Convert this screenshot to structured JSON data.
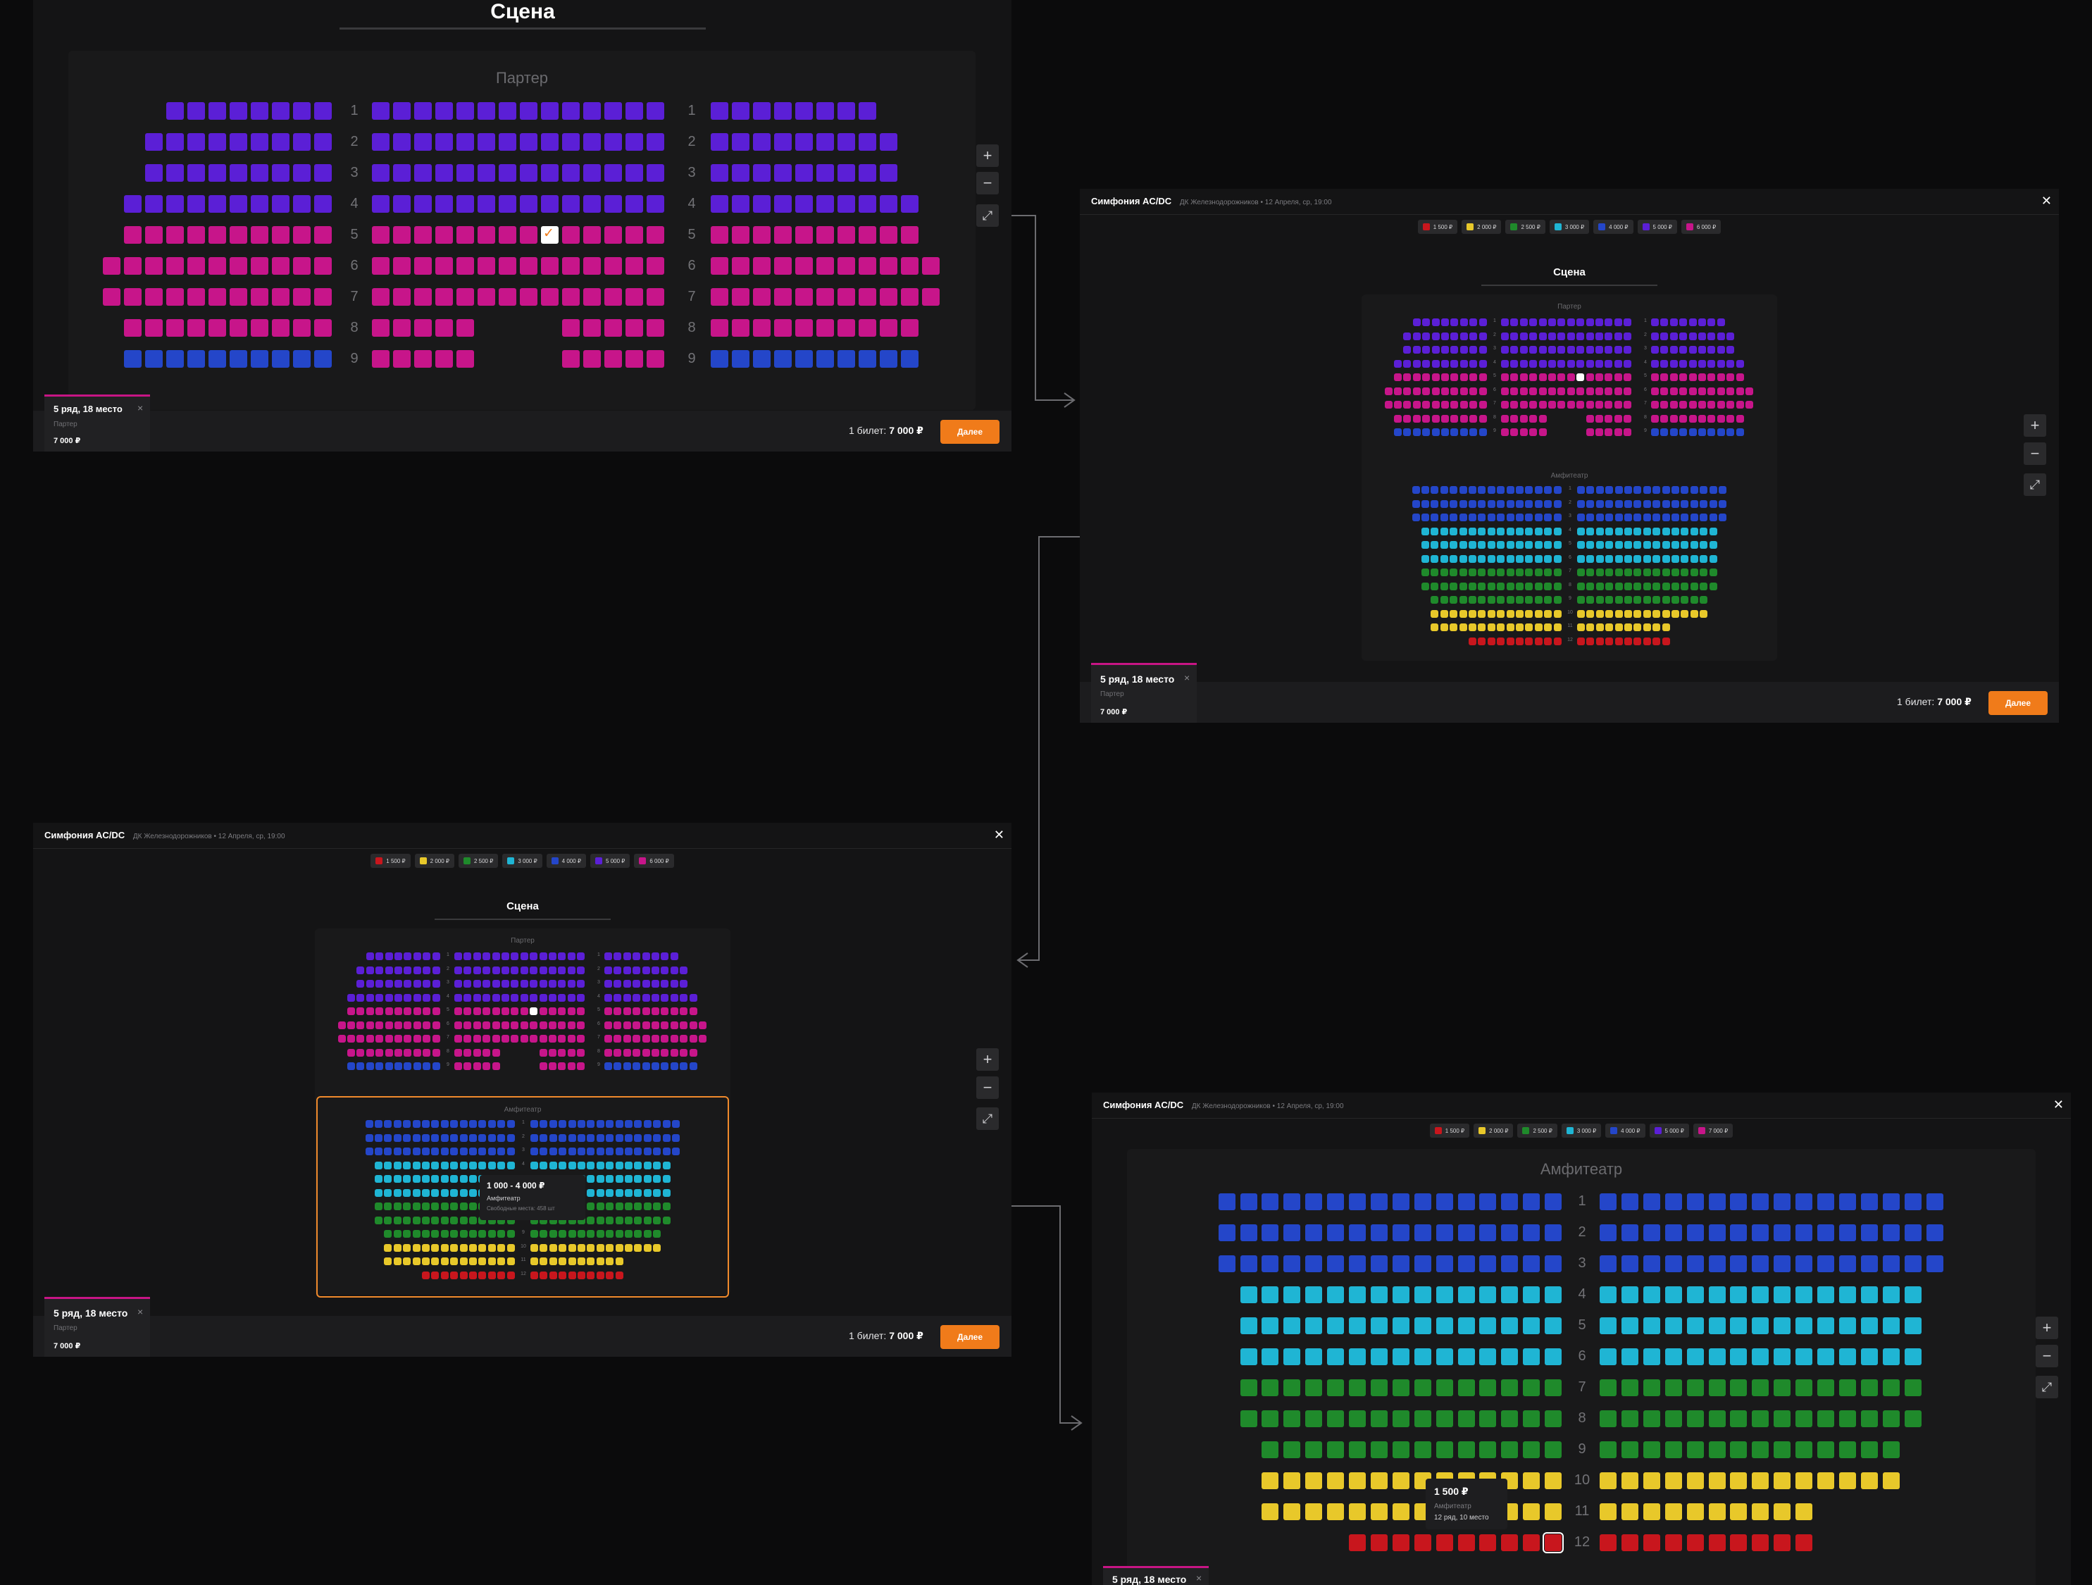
{
  "event": {
    "title": "Симфония AC/DC",
    "subtitle": "ДК Железнодорожников • 12 Апреля, ср, 19:00"
  },
  "legend": {
    "frames_b_c": [
      {
        "price": "1 500 ₽",
        "color": "#c8161d"
      },
      {
        "price": "2 000 ₽",
        "color": "#e8c82a"
      },
      {
        "price": "2 500 ₽",
        "color": "#1f8a2b"
      },
      {
        "price": "3 000 ₽",
        "color": "#1fb5d4"
      },
      {
        "price": "4 000 ₽",
        "color": "#2446c9"
      },
      {
        "price": "5 000 ₽",
        "color": "#5b1fd6"
      },
      {
        "price": "6 000 ₽",
        "color": "#c7158a"
      }
    ],
    "frame_d": [
      {
        "price": "1 500 ₽",
        "color": "#c8161d"
      },
      {
        "price": "2 000 ₽",
        "color": "#e8c82a"
      },
      {
        "price": "2 500 ₽",
        "color": "#1f8a2b"
      },
      {
        "price": "3 000 ₽",
        "color": "#1fb5d4"
      },
      {
        "price": "4 000 ₽",
        "color": "#2446c9"
      },
      {
        "price": "5 000 ₽",
        "color": "#5b1fd6"
      },
      {
        "price": "7 000 ₽",
        "color": "#c7158a"
      }
    ]
  },
  "stage_label": "Сцена",
  "sections": {
    "parter": "Партер",
    "amphi": "Амфитеатр"
  },
  "colors": {
    "purple": "#5b1fd6",
    "magenta": "#c7158a",
    "blue": "#2446c9",
    "cyan": "#1fb5d4",
    "green": "#1f8a2b",
    "yellow": "#e8c82a",
    "red": "#c8161d",
    "accent": "#f07b1a"
  },
  "parter_rows": [
    {
      "row": "1",
      "color": "purple",
      "seats": [
        8,
        14,
        8
      ]
    },
    {
      "row": "2",
      "color": "purple",
      "seats": [
        9,
        14,
        9
      ]
    },
    {
      "row": "3",
      "color": "purple",
      "seats": [
        9,
        14,
        9
      ]
    },
    {
      "row": "4",
      "color": "purple",
      "seats": [
        10,
        14,
        10
      ]
    },
    {
      "row": "5",
      "color": "magenta",
      "seats": [
        10,
        14,
        10
      ]
    },
    {
      "row": "6",
      "color": "magenta",
      "seats": [
        11,
        14,
        11
      ]
    },
    {
      "row": "7",
      "color": "magenta",
      "seats": [
        11,
        14,
        11
      ]
    },
    {
      "row": "8",
      "color": "magenta",
      "seats": [
        10,
        5,
        5,
        10
      ]
    },
    {
      "row": "9",
      "color": "blue",
      "seats": [
        10,
        5,
        5,
        10
      ],
      "middle_color": "magenta"
    }
  ],
  "amphi_rows": [
    {
      "row": "1",
      "color": "blue",
      "seats": [
        16,
        16
      ]
    },
    {
      "row": "2",
      "color": "blue",
      "seats": [
        16,
        16
      ]
    },
    {
      "row": "3",
      "color": "blue",
      "seats": [
        16,
        16
      ]
    },
    {
      "row": "4",
      "color": "cyan",
      "seats": [
        15,
        15
      ]
    },
    {
      "row": "5",
      "color": "cyan",
      "seats": [
        15,
        15
      ]
    },
    {
      "row": "6",
      "color": "cyan",
      "seats": [
        15,
        15
      ]
    },
    {
      "row": "7",
      "color": "green",
      "seats": [
        15,
        15
      ]
    },
    {
      "row": "8",
      "color": "green",
      "seats": [
        15,
        15
      ]
    },
    {
      "row": "9",
      "color": "green",
      "seats": [
        14,
        14
      ]
    },
    {
      "row": "10",
      "color": "yellow",
      "seats": [
        14,
        14
      ]
    },
    {
      "row": "11",
      "color": "yellow",
      "seats": [
        14,
        10
      ]
    },
    {
      "row": "12",
      "color": "red",
      "seats": [
        10,
        10
      ]
    }
  ],
  "controls": {
    "zoom_in": "+",
    "zoom_out": "−",
    "fit": "⤢",
    "close": "✕"
  },
  "ticket": {
    "label": "5 ряд, 18 место",
    "section": "Партер",
    "price": "7 000 ₽",
    "remove": "×"
  },
  "summary": {
    "count": "1 билет:",
    "price": "7 000 ₽",
    "next": "Далее"
  },
  "tooltip_zone": {
    "price": "1 000 - 4 000 ₽",
    "section": "Амфитеатр",
    "free": "Свободные места: 458 шт"
  },
  "tooltip_seat": {
    "price": "1 500 ₽",
    "section": "Амфитеатр",
    "seat": "12 ряд, 10 место"
  }
}
